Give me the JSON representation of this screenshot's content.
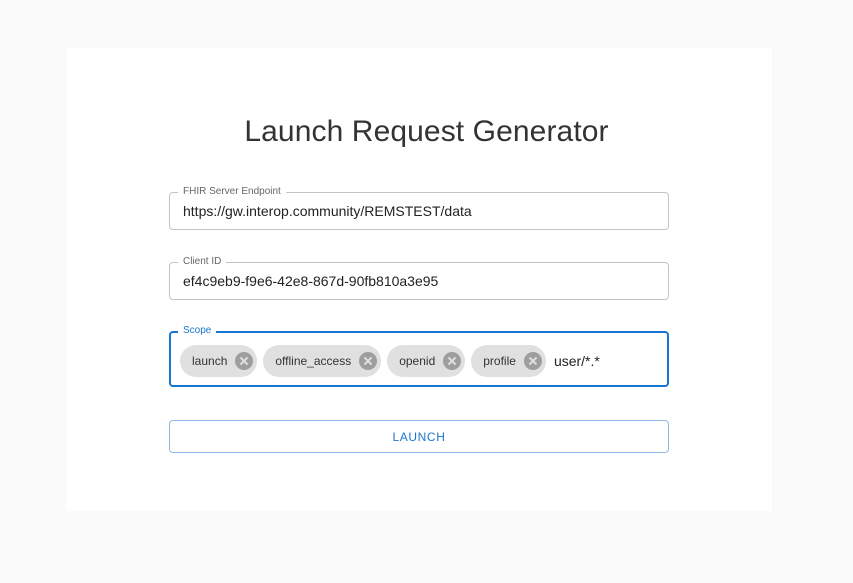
{
  "page": {
    "title": "Launch Request Generator"
  },
  "fhir_endpoint": {
    "label": "FHIR Server Endpoint",
    "value": "https://gw.interop.community/REMSTEST/data"
  },
  "client_id": {
    "label": "Client ID",
    "value": "ef4c9eb9-f9e6-42e8-867d-90fb810a3e95"
  },
  "scope": {
    "label": "Scope",
    "chips": [
      {
        "label": "launch"
      },
      {
        "label": "offline_access"
      },
      {
        "label": "openid"
      },
      {
        "label": "profile"
      }
    ],
    "input_value": "user/*.*"
  },
  "launch_button": {
    "label": "LAUNCH"
  },
  "colors": {
    "accent": "#1976d2",
    "chip_background": "#e0e0e0",
    "page_background": "#fafafa"
  },
  "icons": {
    "chip_delete": "cancel-circle-icon"
  }
}
